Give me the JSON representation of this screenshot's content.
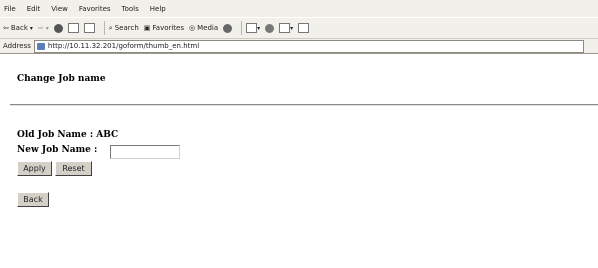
{
  "menu": {
    "items": [
      "File",
      "Edit",
      "View",
      "Favorites",
      "Tools",
      "Help"
    ]
  },
  "toolbar": {
    "back_label": "Back",
    "search_label": "Search",
    "favorites_label": "Favorites",
    "media_label": "Media"
  },
  "address": {
    "label": "Address",
    "url": "http://10.11.32.201/goform/thumb_en.html"
  },
  "page": {
    "title": "Change Job name",
    "old_job_label": "Old Job Name : ABC",
    "new_job_label": "New Job Name :",
    "new_job_value": "",
    "apply_label": "Apply",
    "reset_label": "Reset",
    "back_label": "Back"
  }
}
